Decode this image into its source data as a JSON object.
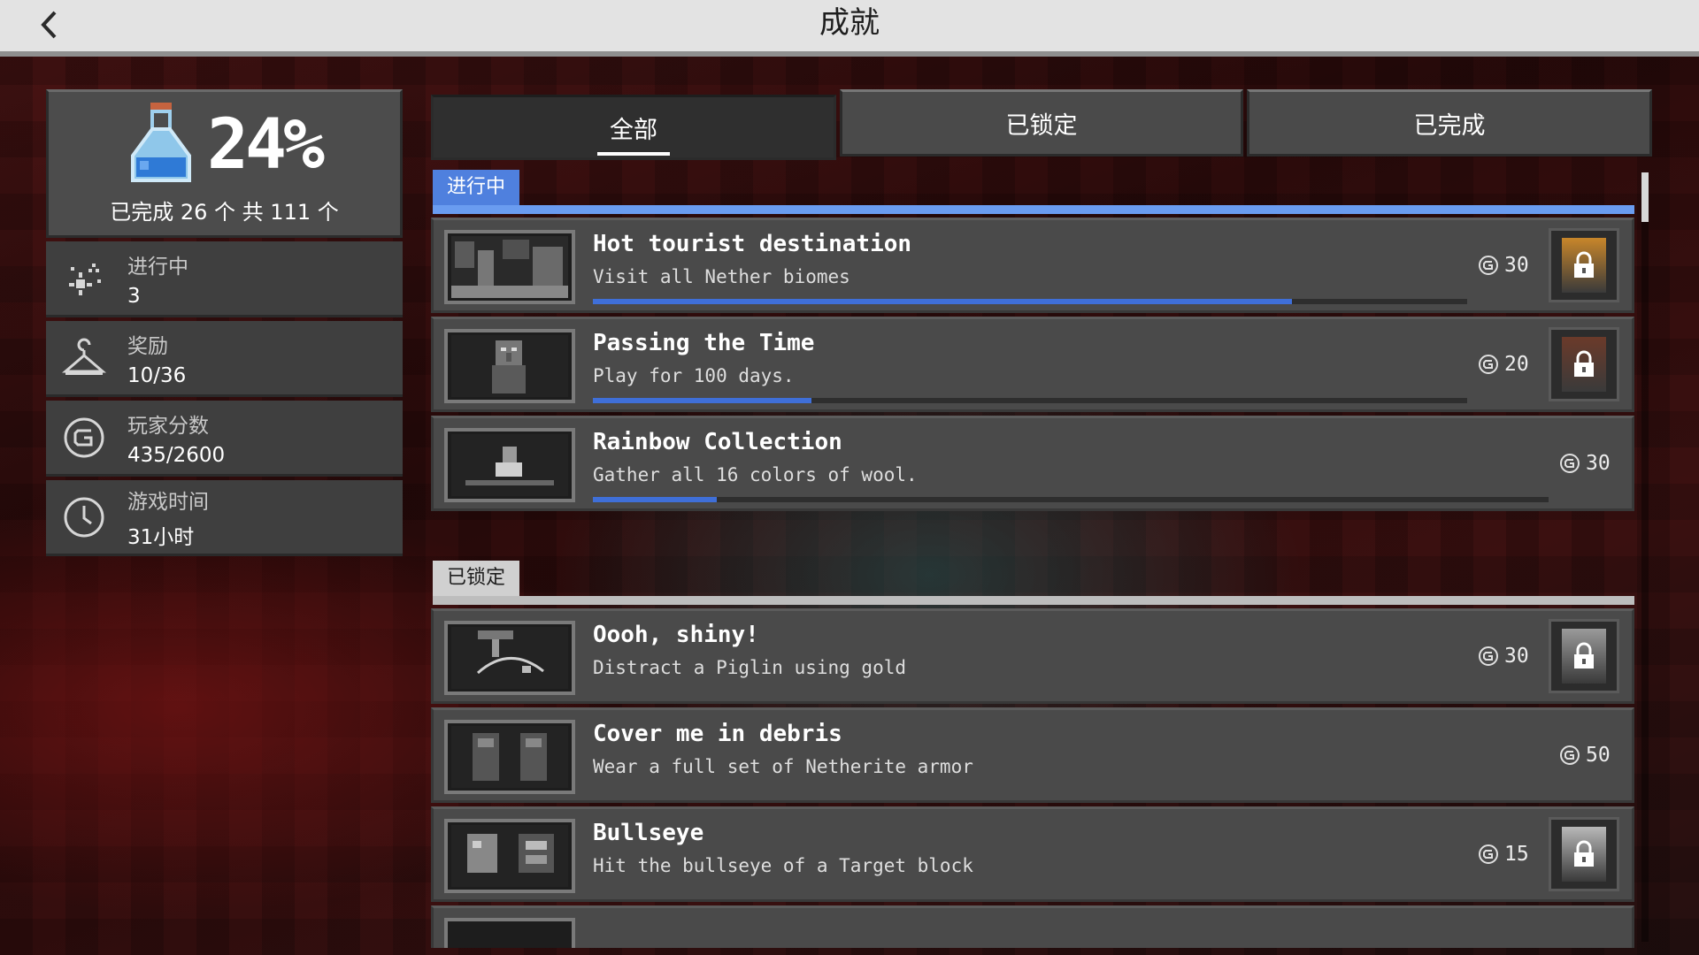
{
  "header": {
    "title": "成就",
    "back_icon": "chevron-left-icon"
  },
  "overview": {
    "percent_text": "24%",
    "percent_value": 0.24,
    "summary": "已完成 26 个 共 111 个",
    "icon": "potion-bottle-icon"
  },
  "stats": [
    {
      "label": "进行中",
      "value": "3",
      "icon": "sparkle-icon"
    },
    {
      "label": "奖励",
      "value": "10/36",
      "icon": "hanger-icon"
    },
    {
      "label": "玩家分数",
      "value": "435/2600",
      "icon": "gamerscore-icon"
    },
    {
      "label": "游戏时间",
      "value": "31小时",
      "icon": "clock-icon"
    }
  ],
  "tabs": [
    {
      "label": "全部",
      "active": true
    },
    {
      "label": "已锁定",
      "active": false
    },
    {
      "label": "已完成",
      "active": false
    }
  ],
  "sections": {
    "in_progress": {
      "label": "进行中",
      "items": [
        {
          "title": "Hot tourist destination",
          "desc": "Visit all Nether biomes",
          "points": "30",
          "progress": 0.8,
          "reward": true,
          "reward_color": "#c8862a"
        },
        {
          "title": "Passing the Time",
          "desc": "Play for 100 days.",
          "points": "20",
          "progress": 0.25,
          "reward": true,
          "reward_color": "#6b3a2a"
        },
        {
          "title": "Rainbow Collection",
          "desc": "Gather all 16 colors of wool.",
          "points": "30",
          "progress": 0.13,
          "reward": false
        }
      ]
    },
    "locked": {
      "label": "已锁定",
      "items": [
        {
          "title": "Oooh, shiny!",
          "desc": "Distract a Piglin using gold",
          "points": "30",
          "reward": true,
          "reward_color": "#9a9a9a"
        },
        {
          "title": "Cover me in debris",
          "desc": "Wear a full set of Netherite armor",
          "points": "50",
          "reward": false
        },
        {
          "title": "Bullseye",
          "desc": "Hit the bullseye of a Target block",
          "points": "15",
          "reward": true,
          "reward_color": "#b8b8b8"
        }
      ]
    }
  }
}
